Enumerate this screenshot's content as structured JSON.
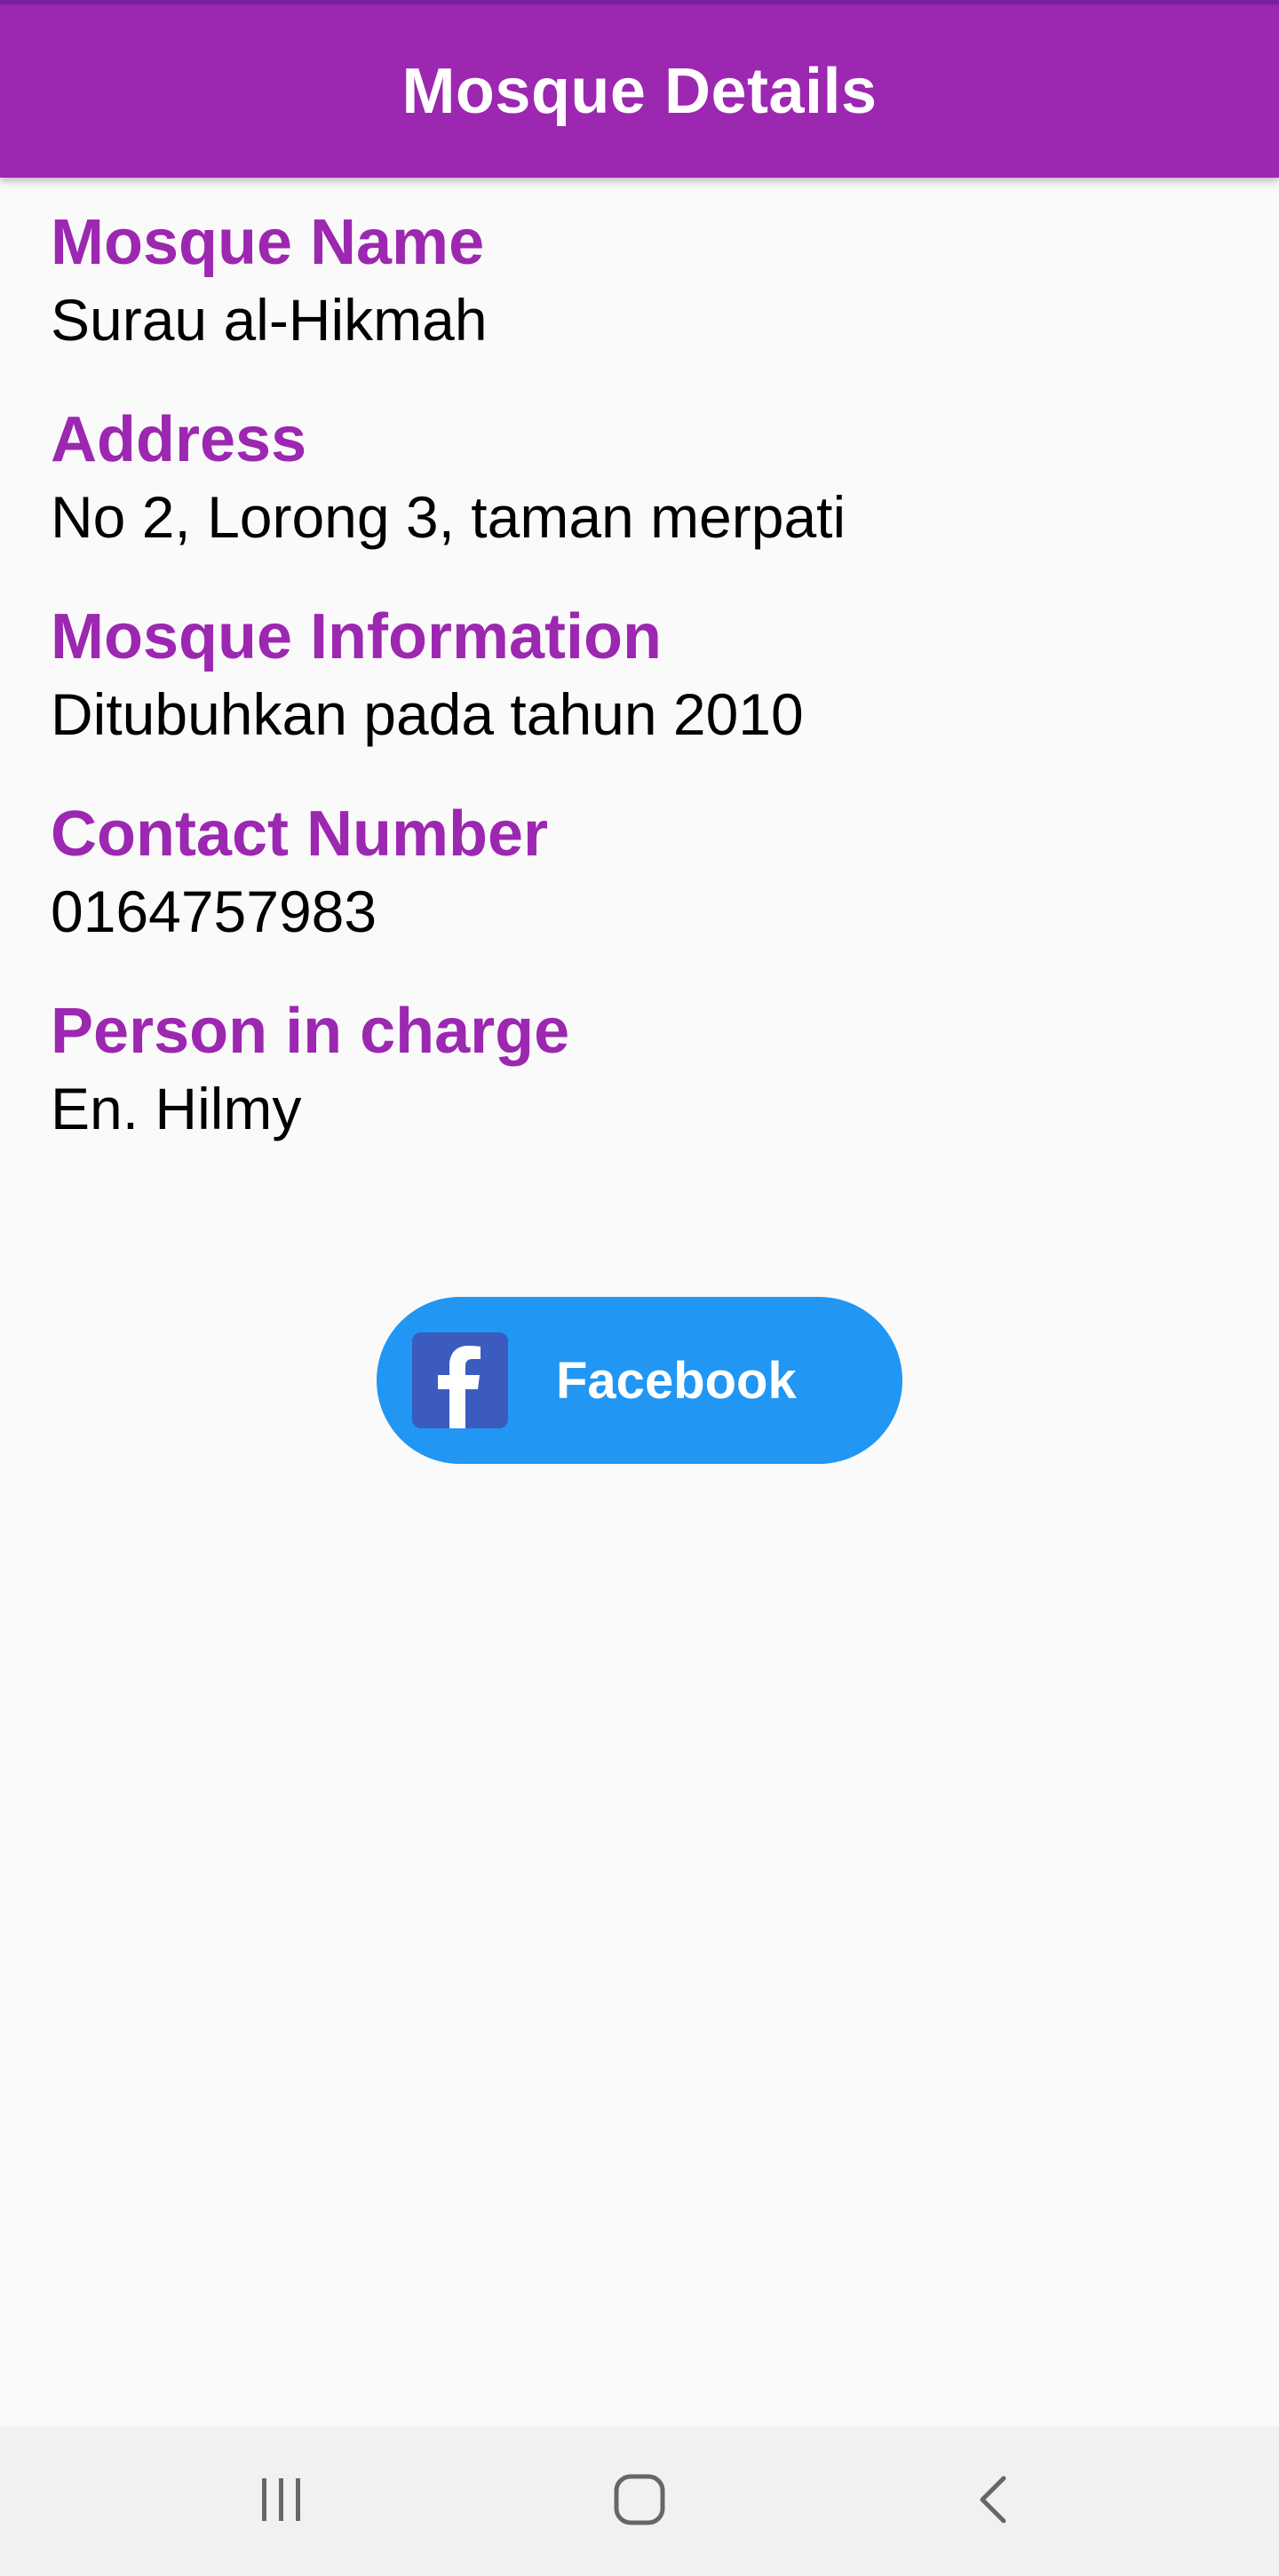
{
  "app_bar": {
    "title": "Mosque Details",
    "color": "#9c27b0"
  },
  "fields": [
    {
      "label": "Mosque Name",
      "value": "Surau al-Hikmah"
    },
    {
      "label": "Address",
      "value": "No 2, Lorong 3, taman merpati"
    },
    {
      "label": "Mosque Information",
      "value": "Ditubuhkan pada tahun 2010"
    },
    {
      "label": "Contact Number",
      "value": "0164757983"
    },
    {
      "label": "Person in charge",
      "value": "En. Hilmy"
    }
  ],
  "facebook_button": {
    "label": "Facebook",
    "icon": "facebook-icon",
    "color": "#2196f3"
  },
  "nav_bar": {
    "icons": [
      "recent-apps-icon",
      "home-icon",
      "back-icon"
    ]
  },
  "colors": {
    "accent": "#9c27b0",
    "button": "#2196f3",
    "background": "#fafafa"
  }
}
